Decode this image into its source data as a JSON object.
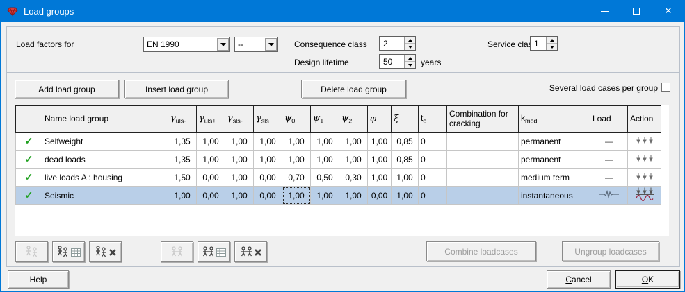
{
  "colors": {
    "titlebar_blue": "#0078d7",
    "dialog_bg": "#f0f0f0",
    "selection_blue": "#b9cfe8",
    "check_green": "#1fa11f",
    "seismic_red": "#9c2440"
  },
  "titlebar": {
    "title": "Load groups"
  },
  "icons": {
    "check": "✓",
    "no_load": "—",
    "close": "✕"
  },
  "load_factors": {
    "label": "Load factors for",
    "code_combo": "EN 1990",
    "annex_combo": "--",
    "consequence_label": "Consequence class",
    "consequence_value": "2",
    "service_label": "Service class",
    "service_value": "1",
    "lifetime_label": "Design lifetime",
    "lifetime_value": "50",
    "lifetime_unit": "years"
  },
  "toolbar": {
    "add": "Add load group",
    "insert": "Insert load group",
    "delete": "Delete load group",
    "several_label": "Several load cases per group",
    "several_checked": false
  },
  "table": {
    "columns": [
      {
        "base": "",
        "sub": ""
      },
      {
        "base": "Name load group",
        "sub": ""
      },
      {
        "base": "γ",
        "sub": "uls-"
      },
      {
        "base": "γ",
        "sub": "uls+"
      },
      {
        "base": "γ",
        "sub": "sls-"
      },
      {
        "base": "γ",
        "sub": "sls+"
      },
      {
        "base": "ψ",
        "sub": "0"
      },
      {
        "base": "ψ",
        "sub": "1"
      },
      {
        "base": "ψ",
        "sub": "2"
      },
      {
        "base": "φ",
        "sub": ""
      },
      {
        "base": "ξ",
        "sub": ""
      },
      {
        "base": "t",
        "sub": "o"
      },
      {
        "base": "Combination for cracking",
        "sub": ""
      },
      {
        "base": "k",
        "sub": "mod"
      },
      {
        "base": "Load",
        "sub": ""
      },
      {
        "base": "Action",
        "sub": ""
      }
    ],
    "rows": [
      {
        "name": "Selfweight",
        "values": [
          "1,35",
          "1,00",
          "1,00",
          "1,00",
          "1,00",
          "1,00",
          "1,00",
          "1,00",
          "0,85",
          "0"
        ],
        "cracking": "",
        "kmod": "permanent",
        "load_icon": "none",
        "action_icon": "distributed-arrows"
      },
      {
        "name": "dead loads",
        "values": [
          "1,35",
          "1,00",
          "1,00",
          "1,00",
          "1,00",
          "1,00",
          "1,00",
          "1,00",
          "0,85",
          "0"
        ],
        "cracking": "",
        "kmod": "permanent",
        "load_icon": "none",
        "action_icon": "distributed-arrows"
      },
      {
        "name": "live loads A : housing",
        "values": [
          "1,50",
          "0,00",
          "1,00",
          "0,00",
          "0,70",
          "0,50",
          "0,30",
          "1,00",
          "1,00",
          "0"
        ],
        "cracking": "",
        "kmod": "medium term",
        "load_icon": "none",
        "action_icon": "distributed-arrows"
      },
      {
        "name": "Seismic",
        "values": [
          "1,00",
          "0,00",
          "1,00",
          "0,00",
          "1,00",
          "1,00",
          "1,00",
          "0,00",
          "1,00",
          "0"
        ],
        "cracking": "",
        "kmod": "instantaneous",
        "load_icon": "seismogram",
        "action_icon": "distributed-arrows-seismic",
        "selected": true
      }
    ]
  },
  "group_toolbar": {
    "combine": "Combine loadcases",
    "ungroup": "Ungroup loadcases"
  },
  "footer": {
    "help": "Help",
    "cancel_accel": "C",
    "cancel_rest": "ancel",
    "ok_accel": "O",
    "ok_rest": "K"
  }
}
